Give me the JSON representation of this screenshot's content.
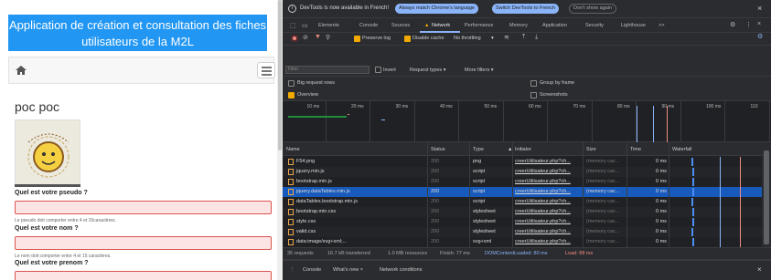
{
  "app": {
    "header_line1": "Application de création et consultation des fiches",
    "header_line2": "utilisateurs de la M2L",
    "title": "poc poc",
    "fields": [
      {
        "label": "Quel est votre pseudo ?",
        "help": "Le pseudo doit comporter entre 4 et 15caractères."
      },
      {
        "label": "Quel est votre nom ?",
        "help": "Le nom doit comporter entre 4 et 15 caractères."
      },
      {
        "label": "Quel est votre prenom ?"
      }
    ],
    "colors": {
      "header": "#2196f3",
      "invalid": "#d9534f"
    }
  },
  "devtools": {
    "info_text": "DevTools is now available in French!",
    "btn_match": "Always match Chrome's language",
    "btn_switch": "Switch DevTools to French",
    "btn_dont": "Don't show again",
    "tabs": [
      "Elements",
      "Console",
      "Sources",
      "Network",
      "Performance",
      "Memory",
      "Application",
      "Security",
      "Lighthouse"
    ],
    "more_tabs": ">>",
    "error_count": "4",
    "toolbar": {
      "preserve_log": "Preserve log",
      "disable_cache": "Disable cache",
      "throttling": "No throttling"
    },
    "filter": {
      "placeholder": "Filter",
      "invert": "Invert",
      "request_types": "Request types",
      "more_filters": "More filters"
    },
    "options": {
      "big_request_rows": "Big request rows",
      "group_by_frame": "Group by frame",
      "overview": "Overview",
      "screenshots": "Screenshots"
    },
    "timeline_ticks": [
      "10 ms",
      "20 ms",
      "30 ms",
      "40 ms",
      "50 ms",
      "60 ms",
      "70 ms",
      "80 ms",
      "90 ms",
      "100 ms",
      "110"
    ],
    "columns": {
      "name": "Name",
      "status": "Status",
      "type": "Type",
      "initiator": "Initiator",
      "size": "Size",
      "time": "Time",
      "waterfall": "Waterfall"
    },
    "rows": [
      {
        "name": "F54.png",
        "status": "200",
        "type": "png",
        "initiator": "creerUtilisateur.php?ch...",
        "size": "(memory cac...",
        "time": "0 ms"
      },
      {
        "name": "jquery.min.js",
        "status": "200",
        "type": "script",
        "initiator": "creerUtilisateur.php?ch...",
        "size": "(memory cac...",
        "time": "0 ms"
      },
      {
        "name": "bootstrap.min.js",
        "status": "200",
        "type": "script",
        "initiator": "creerUtilisateur.php?ch...",
        "size": "(memory cac...",
        "time": "0 ms"
      },
      {
        "name": "jquery.dataTables.min.js",
        "status": "200",
        "type": "script",
        "initiator": "creerUtilisateur.php?ch...",
        "size": "(memory cac...",
        "time": "0 ms"
      },
      {
        "name": "dataTables.bootstrap.min.js",
        "status": "200",
        "type": "script",
        "initiator": "creerUtilisateur.php?ch...",
        "size": "(memory cac...",
        "time": "0 ms"
      },
      {
        "name": "bootstrap.min.css",
        "status": "200",
        "type": "stylesheet",
        "initiator": "creerUtilisateur.php?ch...",
        "size": "(memory cac...",
        "time": "0 ms"
      },
      {
        "name": "style.css",
        "status": "200",
        "type": "stylesheet",
        "initiator": "creerUtilisateur.php?ch...",
        "size": "(memory cac...",
        "time": "0 ms"
      },
      {
        "name": "valid.css",
        "status": "200",
        "type": "stylesheet",
        "initiator": "creerUtilisateur.php?ch...",
        "size": "(memory cac...",
        "time": "0 ms"
      },
      {
        "name": "data:image/svg+xml;...",
        "status": "200",
        "type": "svg+xml",
        "initiator": "creerUtilisateur.php?ch...",
        "size": "(memory cac...",
        "time": "0 ms"
      }
    ],
    "selected_row": 3,
    "status": {
      "requests": "35 requests",
      "transferred": "16.7 kB transferred",
      "resources": "1.0 MB resources",
      "finish": "Finish: 77 ms",
      "dcl": "DOMContentLoaded: 80 ms",
      "load": "Load: 88 ms"
    },
    "drawer": {
      "console": "Console",
      "whats_new": "What's new",
      "network_conditions": "Network conditions"
    },
    "colors": {
      "bg": "#202124",
      "accent": "#8ab4f8",
      "selected": "#185abc",
      "dcl": "#8ab4f8",
      "load": "#f28b82"
    }
  }
}
